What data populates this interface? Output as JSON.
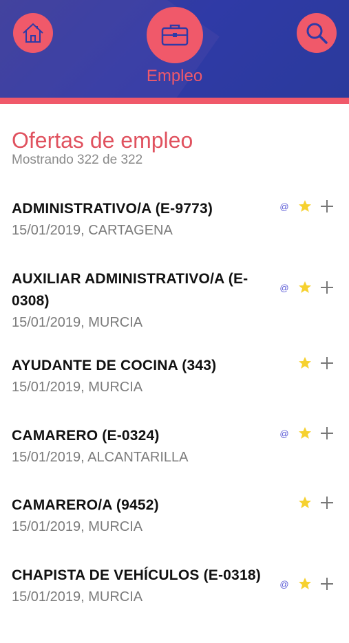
{
  "header": {
    "title": "Empleo",
    "icons": {
      "home": "home-icon",
      "jobs": "briefcase-icon",
      "search": "search-icon"
    },
    "colors": {
      "accent": "#f0596a",
      "background": "#2f3aa6"
    }
  },
  "page": {
    "title": "Ofertas de empleo",
    "subtitle": "Mostrando 322 de 322"
  },
  "offers": [
    {
      "title": "ADMINISTRATIVO/A (E-9773)",
      "meta": "15/01/2019, CARTAGENA",
      "email": true
    },
    {
      "title": "AUXILIAR ADMINISTRATIVO/A (E-0308)",
      "meta": "15/01/2019, MURCIA",
      "email": true
    },
    {
      "title": "AYUDANTE DE COCINA (343)",
      "meta": "15/01/2019, MURCIA",
      "email": false
    },
    {
      "title": "CAMARERO (E-0324)",
      "meta": "15/01/2019, ALCANTARILLA",
      "email": true
    },
    {
      "title": "CAMARERO/A (9452)",
      "meta": "15/01/2019, MURCIA",
      "email": false
    },
    {
      "title": "CHAPISTA DE VEHÍCULOS (E-0318)",
      "meta": "15/01/2019, MURCIA",
      "email": true
    }
  ],
  "icons": {
    "email": "@",
    "favorite": "star-icon",
    "add": "plus-icon"
  }
}
